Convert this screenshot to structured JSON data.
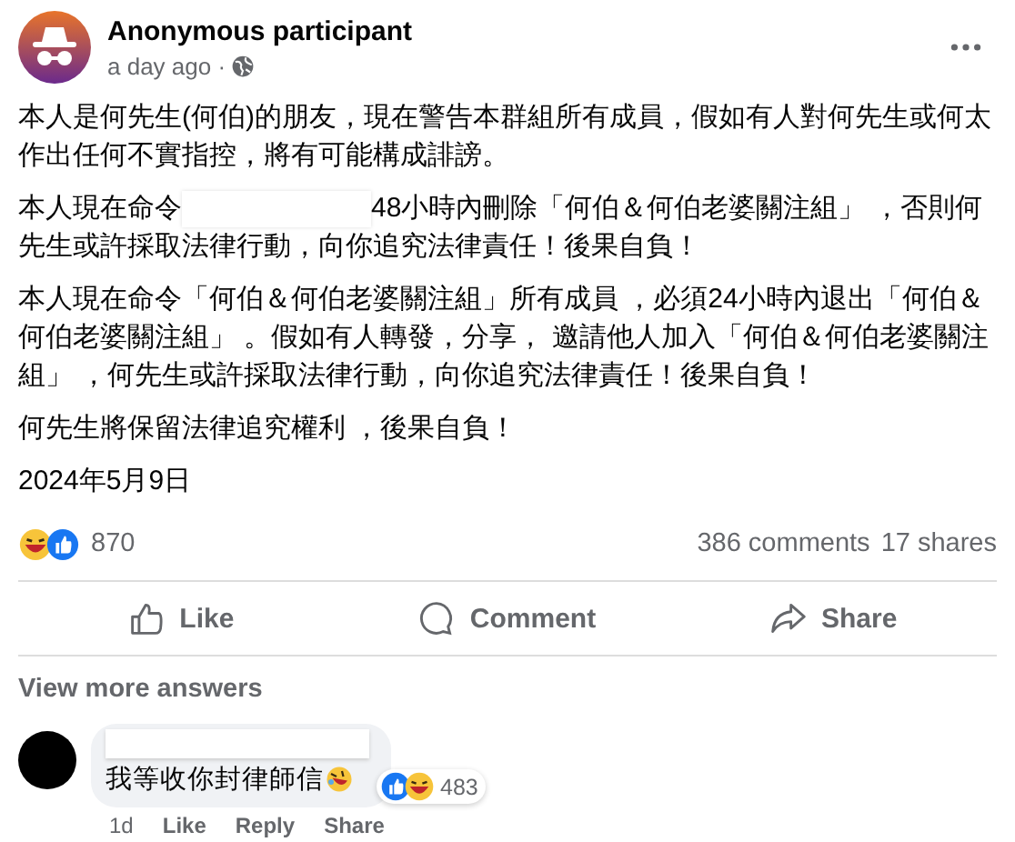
{
  "post": {
    "author": "Anonymous participant",
    "time": "a day ago ·",
    "paragraphs": [
      {
        "kind": "text",
        "text": "本人是何先生(何伯)的朋友，現在警告本群組所有成員，假如有人對何先生或何太作出任何不實指控，將有可能構成誹謗。"
      },
      {
        "kind": "redacted",
        "before": "本人現在命令",
        "after": "48小時內刪除「何伯＆何伯老婆關注組」 ，否則何先生或許採取法律行動，向你追究法律責任！後果自負！"
      },
      {
        "kind": "text",
        "text": "本人現在命令「何伯＆何伯老婆關注組」所有成員 ，必須24小時內退出「何伯＆何伯老婆關注組」 。假如有人轉發，分享， 邀請他人加入「何伯＆何伯老婆關注組」 ，何先生或許採取法律行動，向你追究法律責任！後果自負！"
      },
      {
        "kind": "text",
        "text": "何先生將保留法律追究權利 ，後果自負！"
      },
      {
        "kind": "text",
        "text": "2024年5月9日"
      }
    ],
    "reactions": "870",
    "comments": "386 comments",
    "shares": "17 shares",
    "actions": [
      {
        "kind": "like",
        "label": "Like"
      },
      {
        "kind": "comment",
        "label": "Comment"
      },
      {
        "kind": "share",
        "label": "Share"
      }
    ]
  },
  "view_more": "View more answers",
  "comment": {
    "text": "我等收你封律師信",
    "reactions": "483",
    "time": "1d",
    "actions": [
      "Like",
      "Reply",
      "Share"
    ]
  }
}
